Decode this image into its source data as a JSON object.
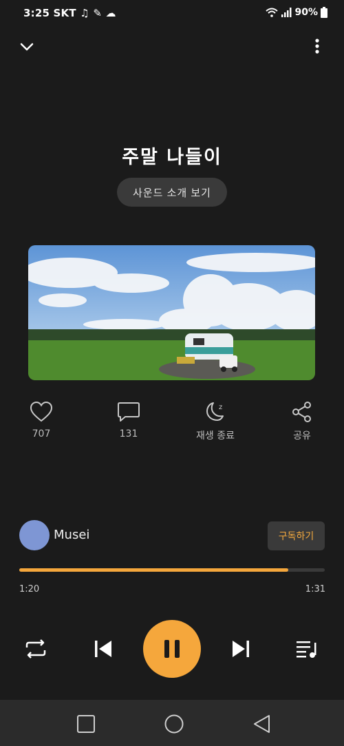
{
  "status_bar": {
    "time": "3:25 SKT",
    "battery": "90%"
  },
  "track": {
    "title": "주말 나들이",
    "intro_label": "사운드 소개 보기"
  },
  "actions": [
    {
      "name": "like",
      "icon": "heart-icon",
      "label": "707"
    },
    {
      "name": "comment",
      "icon": "comment-icon",
      "label": "131"
    },
    {
      "name": "sleep-timer",
      "icon": "moon-icon",
      "label": "재생 종료"
    },
    {
      "name": "share",
      "icon": "share-icon",
      "label": "공유"
    }
  ],
  "artist": {
    "name": "Musei",
    "subscribe_label": "구독하기"
  },
  "player": {
    "current_time": "1:20",
    "total_time": "1:31",
    "progress": 0.881,
    "accent": "#f5a73c"
  }
}
